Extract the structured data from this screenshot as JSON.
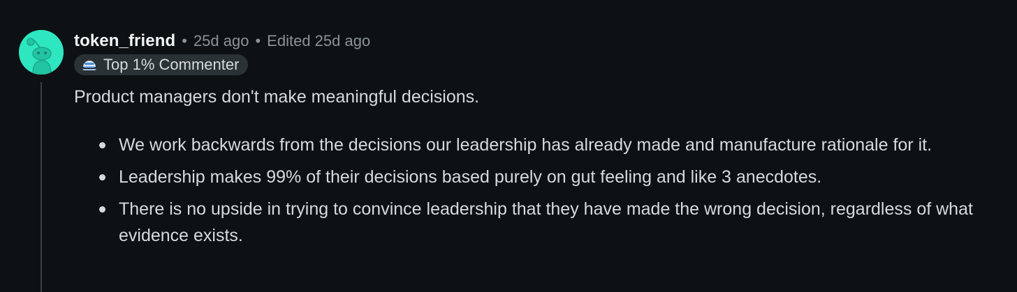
{
  "comment": {
    "author": "token_friend",
    "separator": "•",
    "posted": "25d ago",
    "edited": "Edited 25d ago",
    "badge": {
      "icon": "top-commenter-icon",
      "label": "Top 1% Commenter"
    },
    "avatar_icon": "reddit-snoo-avatar",
    "intro": "Product managers don't make meaningful decisions.",
    "bullets": [
      "We work backwards from the decisions our leadership has already made and manufacture rationale for it.",
      "Leadership makes 99% of their decisions based purely on gut feeling and like 3 anecdotes.",
      "There is no upside in trying to convince leadership that they have made the wrong decision, regardless of what evidence exists."
    ]
  },
  "colors": {
    "background": "#0e1113",
    "avatar": "#2ee6c0",
    "text": "#d7dadc",
    "meta": "#8a9398",
    "badge_bg": "#2a3236"
  }
}
